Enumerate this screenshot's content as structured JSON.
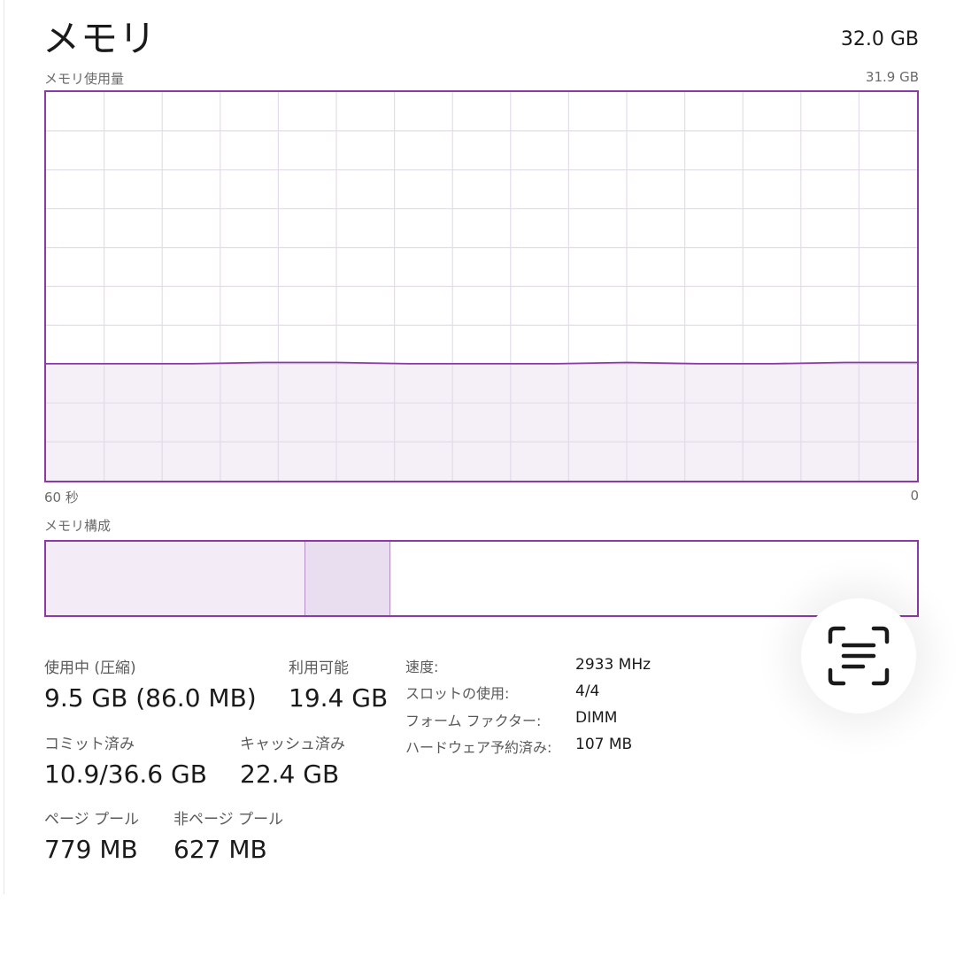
{
  "header": {
    "title": "メモリ",
    "total": "32.0 GB"
  },
  "usage_graph": {
    "label": "メモリ使用量",
    "max_label": "31.9 GB",
    "time_left": "60 秒",
    "time_right": "0"
  },
  "composition": {
    "label": "メモリ構成"
  },
  "stats": {
    "in_use_label": "使用中 (圧縮)",
    "in_use_value": "9.5 GB (86.0 MB)",
    "available_label": "利用可能",
    "available_value": "19.4 GB",
    "committed_label": "コミット済み",
    "committed_value": "10.9/36.6 GB",
    "cached_label": "キャッシュ済み",
    "cached_value": "22.4 GB",
    "paged_label": "ページ プール",
    "paged_value": "779 MB",
    "nonpaged_label": "非ページ プール",
    "nonpaged_value": "627 MB"
  },
  "specs": {
    "speed_label": "速度:",
    "speed_value": "2933 MHz",
    "slots_label": "スロットの使用:",
    "slots_value": "4/4",
    "form_label": "フォーム ファクター:",
    "form_value": "DIMM",
    "reserved_label": "ハードウェア予約済み:",
    "reserved_value": "107 MB"
  },
  "chart_data": {
    "type": "area",
    "ylim": [
      0,
      31.9
    ],
    "xlim": [
      60,
      0
    ],
    "grid": true,
    "series": [
      {
        "x": [
          60,
          55,
          50,
          45,
          40,
          35,
          30,
          25,
          20,
          15,
          10,
          5,
          0
        ],
        "values": [
          9.6,
          9.6,
          9.6,
          9.7,
          9.7,
          9.6,
          9.6,
          9.6,
          9.7,
          9.6,
          9.6,
          9.7,
          9.7
        ]
      }
    ],
    "composition": {
      "in_use_fraction": 0.298,
      "modified_fraction": 0.097
    },
    "colors": {
      "border": "#8a3aa8",
      "fill": "#f3ecf6",
      "grid": "#e3dceb",
      "line": "#8a3aa8"
    }
  },
  "icons": {
    "scan_button": "text-scan-icon"
  }
}
